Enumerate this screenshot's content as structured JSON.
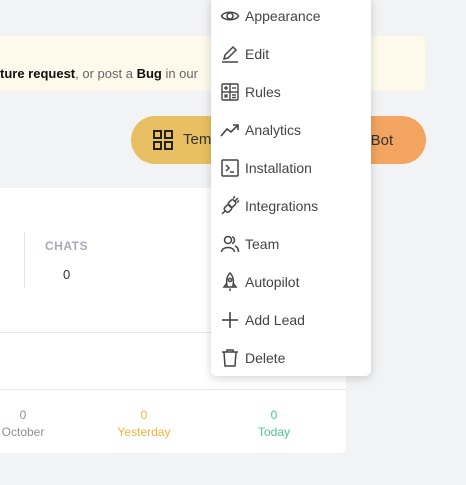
{
  "banner": {
    "part1": "ture request",
    "part2": ", or post a ",
    "part3": "Bug",
    "part4": " in our"
  },
  "buttons": {
    "template_label": "Tem",
    "new_bot_label": "v Bot"
  },
  "stats_card": {
    "chats_label": "CHATS",
    "chats_value": "0",
    "october_value": "0",
    "october_label": "October",
    "yesterday_value": "0",
    "yesterday_label": "Yesterday",
    "today_value": "0",
    "today_label": "Today",
    "colors": {
      "yesterday": "#efb440",
      "today": "#4fc497"
    }
  },
  "menu": {
    "items": [
      {
        "label": "Appearance",
        "icon": "eye-icon"
      },
      {
        "label": "Edit",
        "icon": "pencil-icon"
      },
      {
        "label": "Rules",
        "icon": "calculator-icon"
      },
      {
        "label": "Analytics",
        "icon": "trend-up-icon"
      },
      {
        "label": "Installation",
        "icon": "terminal-icon"
      },
      {
        "label": "Integrations",
        "icon": "plug-icon"
      },
      {
        "label": "Team",
        "icon": "users-icon"
      },
      {
        "label": "Autopilot",
        "icon": "rocket-icon"
      },
      {
        "label": "Add Lead",
        "icon": "plus-icon"
      },
      {
        "label": "Delete",
        "icon": "trash-icon"
      }
    ]
  }
}
